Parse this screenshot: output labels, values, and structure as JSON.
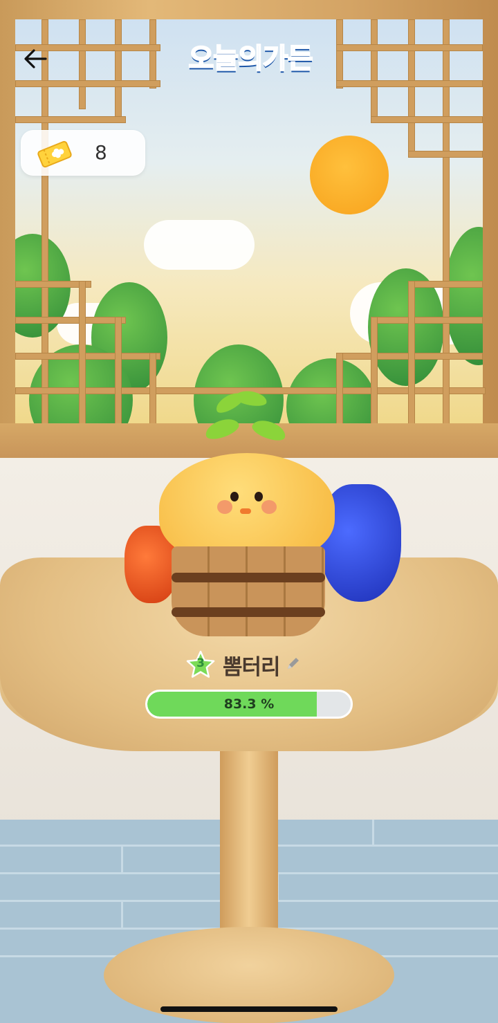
{
  "header": {
    "back_icon": "arrow-left-icon",
    "logo_text": "오늘의가든"
  },
  "tickets": {
    "icon": "clover-ticket-icon",
    "count": "8"
  },
  "plant": {
    "level": "3",
    "name": "뽐터리",
    "edit_icon": "pencil-icon",
    "progress_label": "83.3 %",
    "progress_value": 83.3
  },
  "colors": {
    "progress_fill": "#6fd95a",
    "progress_track": "#e3e6e8",
    "level_star": "#7cdb57"
  }
}
